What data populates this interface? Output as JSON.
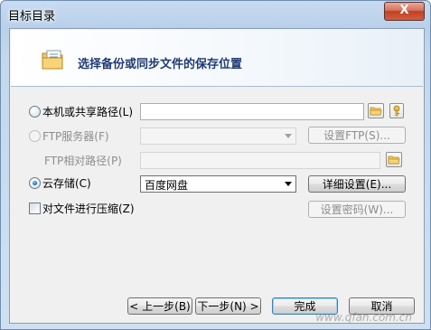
{
  "window": {
    "title": "目标目录",
    "close_label": "X"
  },
  "header": {
    "text": "选择备份或同步文件的保存位置"
  },
  "options": {
    "local_path_label": "本机或共享路径(L)",
    "ftp_server_label": "FTP服务器(F)",
    "ftp_relative_label": "FTP相对路径(P)",
    "cloud_label": "云存储(C)",
    "compress_label": "对文件进行压缩(Z)"
  },
  "fields": {
    "local_path_value": "",
    "ftp_server_value": "",
    "ftp_relative_value": "",
    "cloud_provider_value": "百度网盘"
  },
  "buttons": {
    "set_ftp": "设置FTP(S)...",
    "detail_settings": "详细设置(E)...",
    "set_password": "设置密码(W)...",
    "back": "< 上一步(B)",
    "next": "下一步(N) >",
    "finish": "完成",
    "cancel": "取消"
  },
  "watermark": "www.qfan.com.cn",
  "colors": {
    "accent_blue": "#1f3b74",
    "close_red": "#c23f21"
  }
}
